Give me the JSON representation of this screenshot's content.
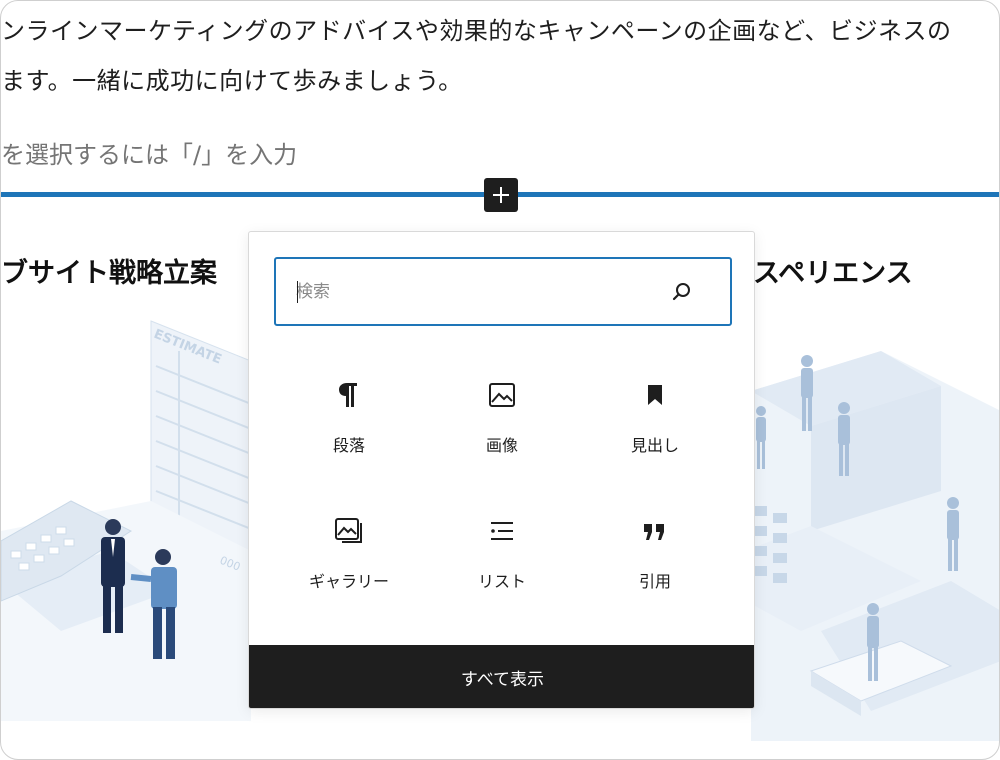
{
  "content": {
    "paragraph_line1": "ンラインマーケティングのアドバイスや効果的なキャンペーンの企画など、ビジネスの",
    "paragraph_line2": "ます。一緒に成功に向けて歩みましょう。",
    "block_placeholder": "を選択するには「/」を入力",
    "heading_left": "ブサイト戦略立案",
    "heading_right": "スペリエンス",
    "illustration_left_text": "ESTIMATE"
  },
  "inserter": {
    "search": {
      "placeholder": "検索",
      "value": ""
    },
    "blocks": [
      {
        "label": "段落",
        "icon": "paragraph-icon"
      },
      {
        "label": "画像",
        "icon": "image-icon"
      },
      {
        "label": "見出し",
        "icon": "heading-icon"
      },
      {
        "label": "ギャラリー",
        "icon": "gallery-icon"
      },
      {
        "label": "リスト",
        "icon": "list-icon"
      },
      {
        "label": "引用",
        "icon": "quote-icon"
      }
    ],
    "show_all_label": "すべて表示"
  },
  "colors": {
    "accent": "#1e75b8",
    "dark": "#1e1e1e",
    "illustration_light": "#e3ecf5",
    "illustration_mid": "#b9cde2",
    "figure_navy": "#1c2d4f",
    "figure_blue": "#4a7fb5"
  }
}
